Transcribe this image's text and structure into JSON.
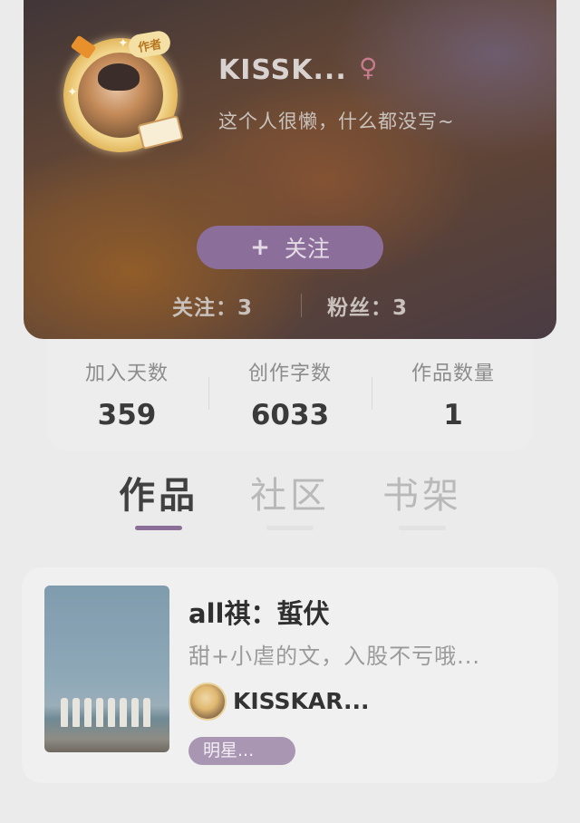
{
  "profile": {
    "avatar_badge": "作者",
    "username": "KISSK...",
    "gender_icon": "female-icon",
    "gender_symbol": "♀",
    "bio": "这个人很懒，什么都没写~",
    "follow_button": {
      "icon": "plus-icon",
      "icon_symbol": "+",
      "label": "关注"
    },
    "following": "关注：3",
    "followers": "粉丝：3"
  },
  "stats": [
    {
      "label": "加入天数",
      "value": "359"
    },
    {
      "label": "创作字数",
      "value": "6033"
    },
    {
      "label": "作品数量",
      "value": "1"
    }
  ],
  "tabs": [
    {
      "label": "作品",
      "active": true
    },
    {
      "label": "社区",
      "active": false
    },
    {
      "label": "书架",
      "active": false
    }
  ],
  "works": [
    {
      "title": "all祺：蜇伏",
      "description": "甜+小虐的文，入股不亏哦...",
      "author": "KISSKAR...",
      "tag": "明星..."
    }
  ],
  "colors": {
    "accent": "#8b6e9a",
    "background": "#ebebeb"
  }
}
